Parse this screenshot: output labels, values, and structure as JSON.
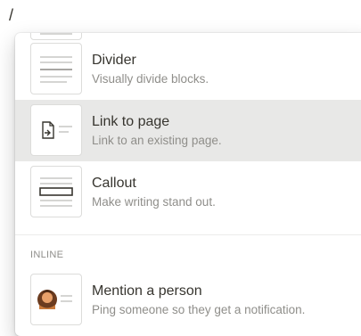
{
  "input": {
    "text": "/"
  },
  "menu": {
    "items": [
      {
        "title": "Divider",
        "description": "Visually divide blocks.",
        "icon": "divider-icon",
        "selected": false
      },
      {
        "title": "Link to page",
        "description": "Link to an existing page.",
        "icon": "link-to-page-icon",
        "selected": true
      },
      {
        "title": "Callout",
        "description": "Make writing stand out.",
        "icon": "callout-icon",
        "selected": false
      }
    ],
    "section": {
      "label": "INLINE"
    },
    "inline_items": [
      {
        "title": "Mention a person",
        "description": "Ping someone so they get a notification.",
        "icon": "person-avatar-icon",
        "selected": false
      }
    ]
  },
  "colors": {
    "selected_bg": "#e8e8e7",
    "text": "#37352f",
    "muted": "#8f8e8a"
  }
}
